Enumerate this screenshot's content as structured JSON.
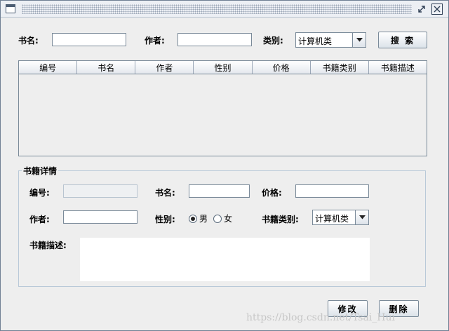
{
  "search": {
    "name_label": "书名:",
    "author_label": "作者:",
    "category_label": "类别:",
    "category_value": "计算机类",
    "search_button": "搜 索"
  },
  "table": {
    "columns": [
      "编号",
      "书名",
      "作者",
      "性别",
      "价格",
      "书籍类别",
      "书籍描述"
    ],
    "rows": []
  },
  "details": {
    "group_title": "书籍详情",
    "id_label": "编号:",
    "name_label": "书名:",
    "price_label": "价格:",
    "author_label": "作者:",
    "gender_label": "性别:",
    "gender_male": "男",
    "gender_female": "女",
    "gender_selected": "男",
    "category_label": "书籍类别:",
    "category_value": "计算机类",
    "description_label": "书籍描述:"
  },
  "actions": {
    "modify_button": "修改",
    "delete_button": "删除"
  },
  "watermark": "https://blog.csdn.net/Tsai_Hui"
}
